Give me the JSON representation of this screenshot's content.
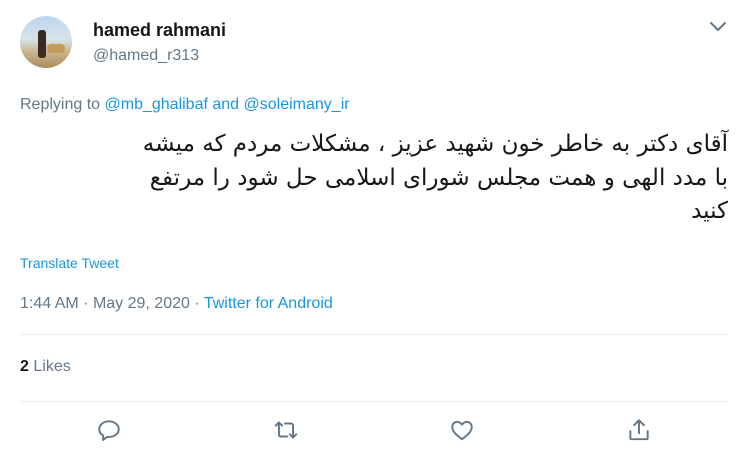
{
  "author": {
    "name": "hamed rahmani",
    "handle": "@hamed_r313"
  },
  "reply": {
    "prefix": "Replying to",
    "mention_1": "@mb_ghalibaf",
    "and": "and",
    "mention_2": "@soleimany_ir"
  },
  "tweet": {
    "line_1": "آقای دکتر به خاطر خون شهید عزیز ، مشکلات مردم که میشه",
    "line_2": "با مدد الهی و همت مجلس شورای اسلامی حل شود را مرتفع",
    "line_3": "کنید"
  },
  "translate_label": "Translate Tweet",
  "meta": {
    "time": "1:44 AM",
    "separator": "·",
    "date": "May 29, 2020",
    "source": "Twitter for Android"
  },
  "stats": {
    "likes_count": "2",
    "likes_label": "Likes"
  },
  "icons": {
    "menu": "chevron-down-icon",
    "reply": "reply-icon",
    "retweet": "retweet-icon",
    "like": "heart-icon",
    "share": "share-icon"
  },
  "colors": {
    "accent": "#1b95e0",
    "muted": "#657786",
    "text": "#14171a",
    "divider": "#e6ecf0"
  }
}
